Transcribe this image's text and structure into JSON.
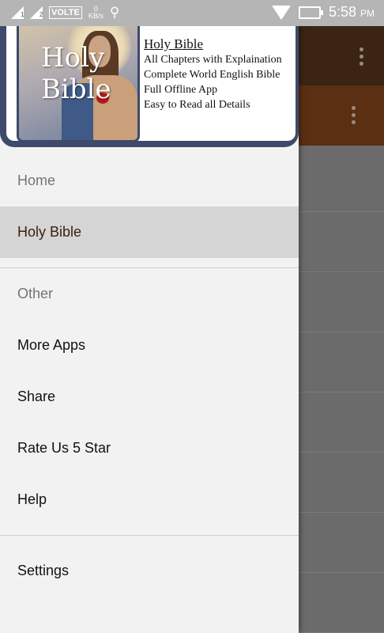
{
  "status_bar": {
    "sim1": "1",
    "sim2": "2",
    "volte": "VOLTE",
    "speed_value": "0",
    "speed_unit": "KB/s",
    "time": "5:58",
    "ampm": "PM"
  },
  "drawer": {
    "header": {
      "image_title": "Holy Bible",
      "title": "Holy Bible",
      "lines": [
        "All Chapters with Explaination",
        "Complete World English Bible",
        "Full Offline App",
        "Easy to Read all Details"
      ]
    },
    "sections": [
      {
        "label": "Home",
        "items": [
          "Holy Bible"
        ],
        "active": "Holy Bible"
      },
      {
        "label": "Other",
        "items": [
          "More Apps",
          "Share",
          "Rate Us 5 Star",
          "Help"
        ]
      },
      {
        "label": "",
        "items": [
          "Settings"
        ]
      }
    ]
  },
  "colors": {
    "header_frame": "#3d4a6b",
    "drawer_bg": "#f2f2f2",
    "active_item_bg": "#d5d5d5",
    "toolbar_bg": "#3b2414"
  }
}
